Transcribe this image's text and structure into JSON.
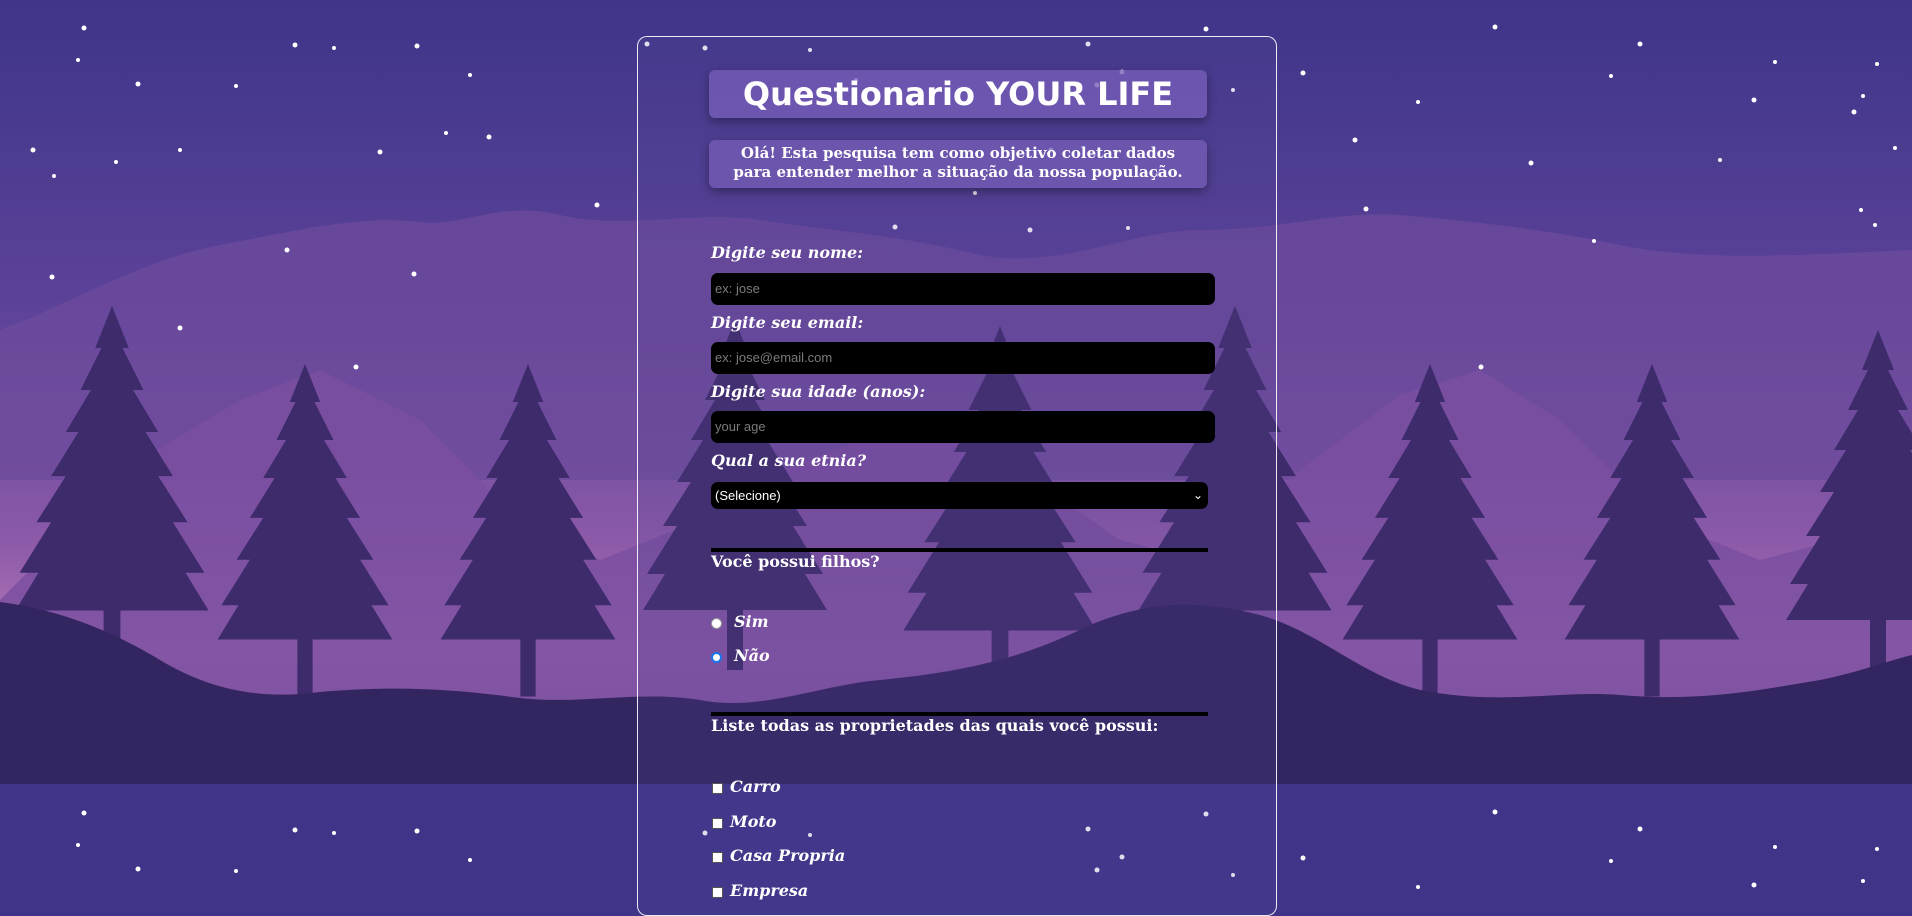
{
  "title": "Questionario YOUR LIFE",
  "intro": "Olá! Esta pesquisa tem como objetivo coletar dados para entender melhor a situação da nossa população.",
  "fields": {
    "name_label": "Digite seu nome:",
    "name_placeholder": "ex: jose",
    "email_label": "Digite seu email:",
    "email_placeholder": "ex: jose@email.com",
    "age_label": "Digite sua idade (anos):",
    "age_placeholder": "your age",
    "ethnicity_label": "Qual a sua etnia?",
    "ethnicity_selected": "(Selecione)"
  },
  "children": {
    "question": "Você possui filhos?",
    "options": [
      {
        "label": "Sim",
        "checked": false
      },
      {
        "label": "Não",
        "checked": true
      }
    ]
  },
  "properties": {
    "question": "Liste todas as proprietades das quais você possui:",
    "options": [
      "Carro",
      "Moto",
      "Casa Propria",
      "Empresa"
    ]
  },
  "icons": {
    "select_arrow": "chevron-down-icon"
  },
  "colors": {
    "sky_top": "#3e3589",
    "sky_mid": "#7a4fa7",
    "horizon": "#b978b8",
    "trees": "#3d2b6b",
    "ground": "#332560"
  }
}
